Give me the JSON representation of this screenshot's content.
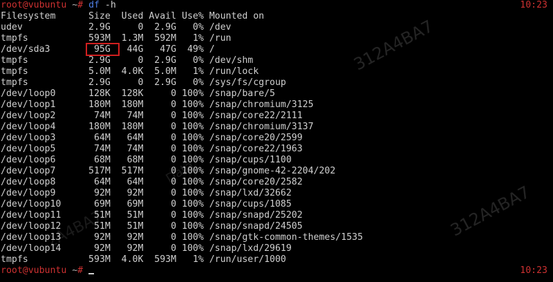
{
  "terminal": {
    "prompt_user": "root@vubuntu",
    "prompt_path": " ~",
    "prompt_symbol": "#",
    "command": "df",
    "command_args": " -h",
    "clock_top": "10:23",
    "clock_bottom": "10:23",
    "final_prompt_user": "root@vubuntu",
    "final_prompt_path": " ~",
    "final_prompt_symbol": "#"
  },
  "table": {
    "header": "Filesystem      Size  Used Avail Use% Mounted on",
    "rows": [
      "udev            2.9G     0  2.9G   0% /dev",
      "tmpfs           593M  1.3M  592M   1% /run",
      "/dev/sda3        95G   44G   47G  49% /",
      "tmpfs           2.9G     0  2.9G   0% /dev/shm",
      "tmpfs           5.0M  4.0K  5.0M   1% /run/lock",
      "tmpfs           2.9G     0  2.9G   0% /sys/fs/cgroup",
      "/dev/loop0      128K  128K     0 100% /snap/bare/5",
      "/dev/loop1      180M  180M     0 100% /snap/chromium/3125",
      "/dev/loop2       74M   74M     0 100% /snap/core22/2111",
      "/dev/loop4      180M  180M     0 100% /snap/chromium/3137",
      "/dev/loop3       64M   64M     0 100% /snap/core20/2599",
      "/dev/loop5       74M   74M     0 100% /snap/core22/1963",
      "/dev/loop6       68M   68M     0 100% /snap/cups/1100",
      "/dev/loop7      517M  517M     0 100% /snap/gnome-42-2204/202",
      "/dev/loop8       64M   64M     0 100% /snap/core20/2582",
      "/dev/loop9       92M   92M     0 100% /snap/lxd/32662",
      "/dev/loop10      69M   69M     0 100% /snap/cups/1085",
      "/dev/loop11      51M   51M     0 100% /snap/snapd/25202",
      "/dev/loop12      51M   51M     0 100% /snap/snapd/24505",
      "/dev/loop13      92M   92M     0 100% /snap/gtk-common-themes/1535",
      "/dev/loop14      92M   92M     0 100% /snap/lxd/29619",
      "tmpfs           593M  4.0K  593M   1% /run/user/1000"
    ]
  },
  "watermarks": {
    "mark_a": "312A4BA7",
    "mark_b": "312A4BA7",
    "mark_c": "2A4BA7",
    "mark_d": "Data"
  },
  "colors": {
    "background": "#000000",
    "text": "#d0d0d0",
    "prompt": "#cd3131",
    "command": "#4f7fe6",
    "highlight_box": "#d11f1f"
  }
}
